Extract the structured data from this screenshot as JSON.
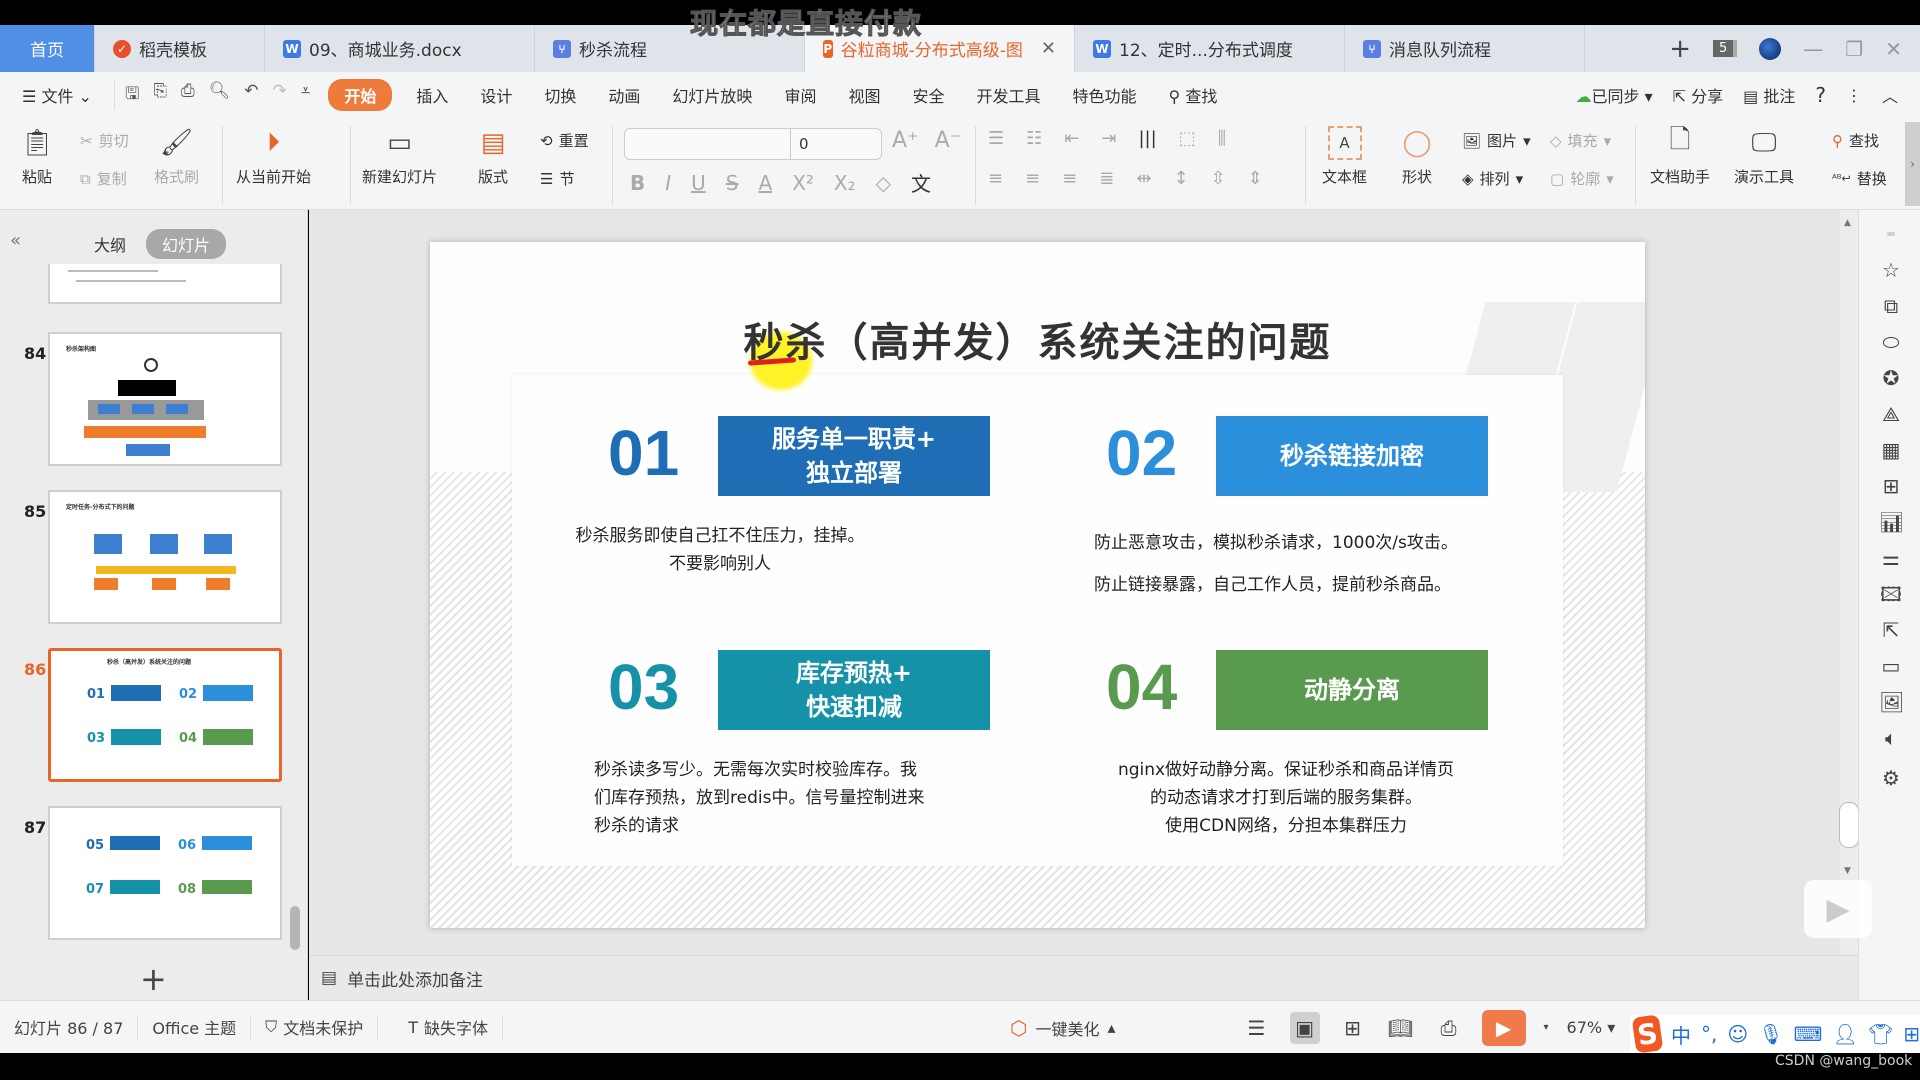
{
  "overlay_caption": "现在都是直接付款",
  "tabs": [
    {
      "label": "首页",
      "type": "home"
    },
    {
      "label": "稻壳模板",
      "icon": "docer-icon"
    },
    {
      "label": "09、商城业务.docx",
      "icon": "word-icon"
    },
    {
      "label": "秒杀流程",
      "icon": "flow-icon"
    },
    {
      "label": "谷粒商城-分布式高级-图",
      "icon": "ppt-icon",
      "active": true
    },
    {
      "label": "12、定时...分布式调度",
      "icon": "word-icon"
    },
    {
      "label": "消息队列流程",
      "icon": "flow-icon"
    }
  ],
  "tab_controls": {
    "new_tab": "+",
    "tab_count": "5"
  },
  "menu": {
    "file": "文件",
    "items": [
      "开始",
      "插入",
      "设计",
      "切换",
      "动画",
      "幻灯片放映",
      "审阅",
      "视图",
      "安全",
      "开发工具",
      "特色功能"
    ],
    "search": "查找",
    "sync": "已同步",
    "share": "分享",
    "comment": "批注",
    "help": "?"
  },
  "ribbon": {
    "paste": "粘贴",
    "cut": "剪切",
    "copy": "复制",
    "format_painter": "格式刷",
    "play_from_current": "从当前开始",
    "new_slide": "新建幻灯片",
    "layout": "版式",
    "reset": "重置",
    "section": "节",
    "font_name": "",
    "font_size": "0",
    "textbox": "文本框",
    "shape": "形状",
    "picture": "图片",
    "arrange": "排列",
    "fill": "填充",
    "outline": "轮廓",
    "doc_assistant": "文档助手",
    "present_tools": "演示工具",
    "find": "查找",
    "replace": "替换"
  },
  "left_panel": {
    "tab_outline": "大纲",
    "tab_slides": "幻灯片",
    "thumbnails": [
      {
        "number": "84",
        "title": "秒杀架构图"
      },
      {
        "number": "85",
        "title": "定时任务-分布式下的问题"
      },
      {
        "number": "86",
        "title": "秒杀（高并发）系统关注的问题",
        "selected": true
      },
      {
        "number": "87",
        "title": ""
      }
    ],
    "add_slide": "+"
  },
  "slide": {
    "title": "秒杀（高并发）系统关注的问题",
    "items": [
      {
        "number": "01",
        "label": "服务单一职责+\n独立部署",
        "color": "#1f6db5",
        "description": "秒杀服务即使自己扛不住压力，挂掉。\n不要影响别人"
      },
      {
        "number": "02",
        "label": "秒杀链接加密",
        "color": "#2b8fdc",
        "description": "防止恶意攻击，模拟秒杀请求，1000次/s攻击。\n防止链接暴露，自己工作人员，提前秒杀商品。"
      },
      {
        "number": "03",
        "label": "库存预热+\n快速扣减",
        "color": "#1591a8",
        "description": "秒杀读多写少。无需每次实时校验库存。我\n们库存预热，放到redis中。信号量控制进来\n秒杀的请求"
      },
      {
        "number": "04",
        "label": "动静分离",
        "color": "#5a9a4e",
        "description": "nginx做好动静分离。保证秒杀和商品详情页\n的动态请求才打到后端的服务集群。\n使用CDN网络，分担本集群压力"
      }
    ]
  },
  "notes_placeholder": "单击此处添加备注",
  "status": {
    "slide_counter": "幻灯片 86 / 87",
    "theme": "Office 主题",
    "protection": "文档未保护",
    "missing_fonts": "缺失字体",
    "beautify": "一键美化",
    "zoom": "67%"
  },
  "ime": {
    "mode": "中",
    "punct": "°,"
  },
  "watermark": "CSDN @wang_book",
  "colors": {
    "accent": "#e8652a",
    "home_tab": "#4f8fe6"
  }
}
